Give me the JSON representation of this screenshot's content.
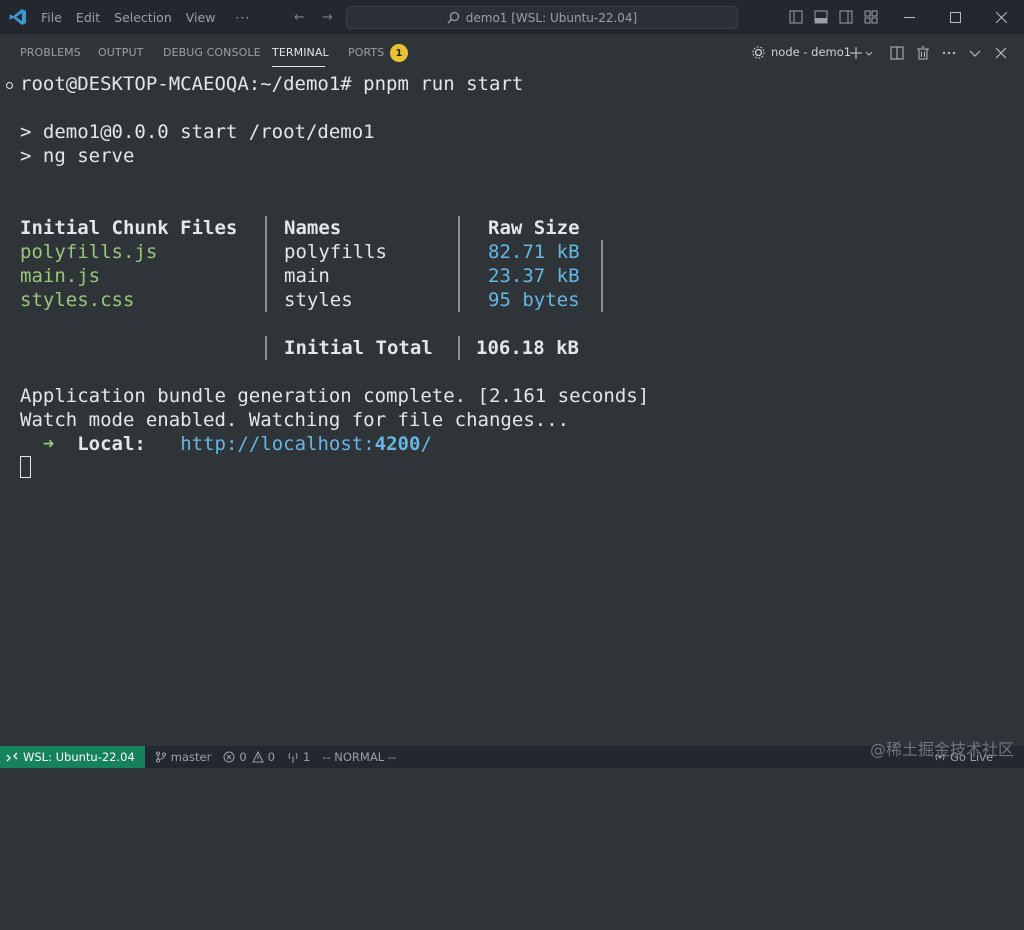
{
  "titlebar": {
    "menus": [
      "File",
      "Edit",
      "Selection",
      "View"
    ],
    "more": "···",
    "command_center": "demo1 [WSL: Ubuntu-22.04]"
  },
  "panel": {
    "tabs": [
      "PROBLEMS",
      "OUTPUT",
      "DEBUG CONSOLE",
      "TERMINAL",
      "PORTS"
    ],
    "active_tab": "TERMINAL",
    "ports_count": "1",
    "terminal_name": "node - demo1"
  },
  "terminal": {
    "prompt": "root@DESKTOP-MCAEOQA:~/demo1# ",
    "command": "pnpm run start",
    "script_line_1": "> demo1@0.0.0 start /root/demo1",
    "script_line_2": "> ng serve",
    "table": {
      "headers": [
        "Initial Chunk Files",
        "Names",
        "Raw Size"
      ],
      "rows": [
        {
          "file": "polyfills.js",
          "name": "polyfills",
          "size": "82.71 kB"
        },
        {
          "file": "main.js",
          "name": "main",
          "size": "23.37 kB"
        },
        {
          "file": "styles.css",
          "name": "styles",
          "size": "95 bytes"
        }
      ],
      "total_label": "Initial Total",
      "total_value": "106.18 kB"
    },
    "bundle_msg": "Application bundle generation complete. [2.161 seconds]",
    "watch_msg": "Watch mode enabled. Watching for file changes...",
    "arrow": "➜",
    "local_label": "Local:",
    "url_prefix": "http://localhost:",
    "url_port": "4200",
    "url_suffix": "/"
  },
  "statusbar": {
    "remote": "WSL: Ubuntu-22.04",
    "branch": "master",
    "errors": "0",
    "warnings": "0",
    "ports": "1",
    "mode": "-- NORMAL --",
    "go_live": "Go Live"
  },
  "watermark": "@稀土掘金技术社区",
  "colors": {
    "background": "#2f3439",
    "titlebar": "#23272e",
    "remote_badge": "#16825d",
    "ports_badge": "#e8c234",
    "file_green": "#98c77a",
    "size_cyan": "#66b7e3"
  }
}
